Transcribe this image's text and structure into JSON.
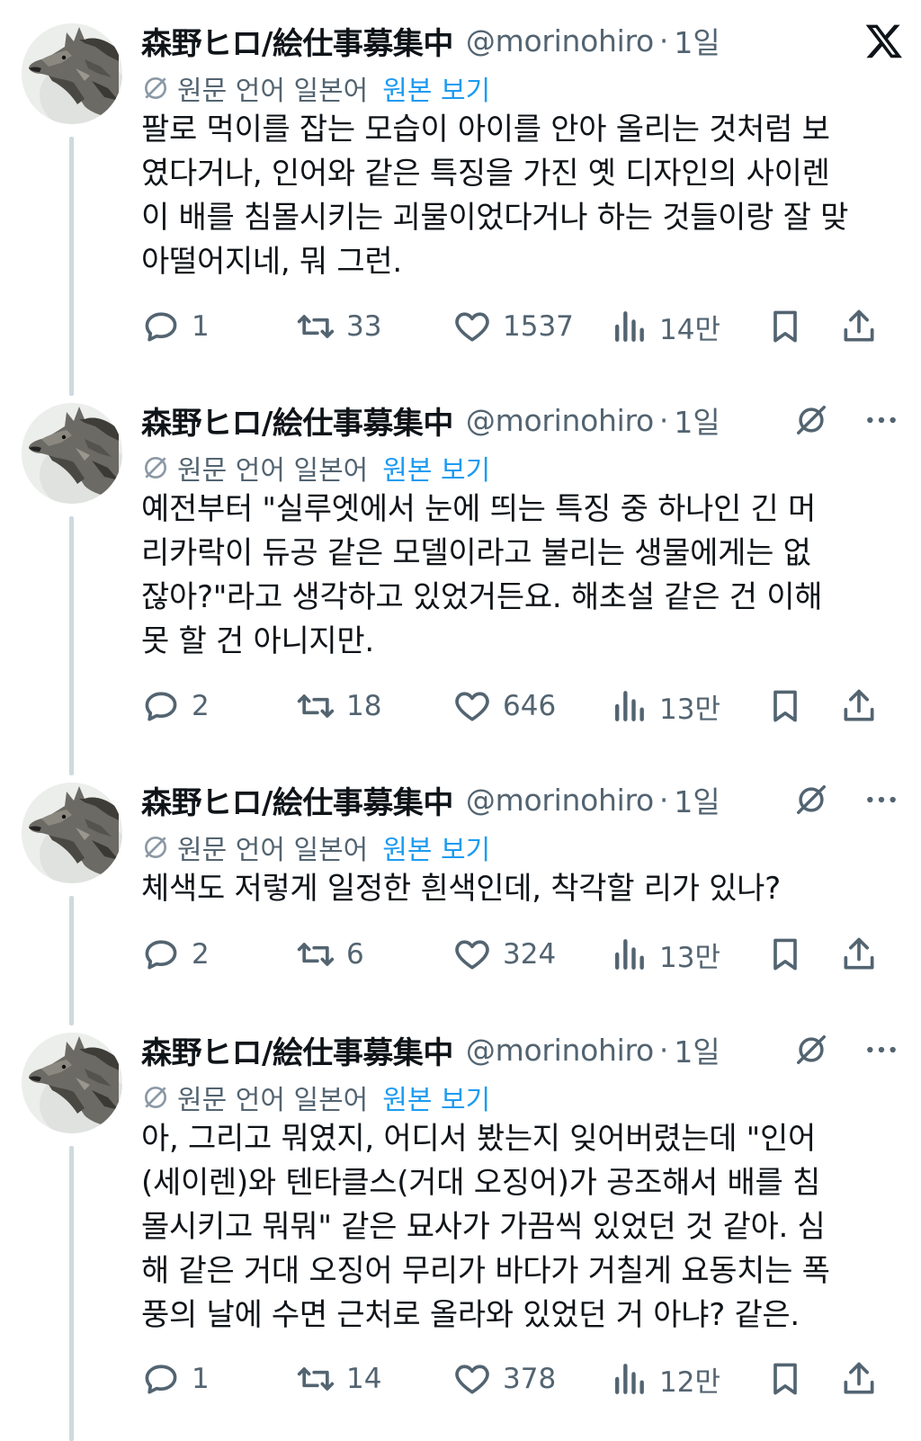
{
  "author": {
    "display_name": "森野ヒロ/絵仕事募集中",
    "handle": "@morinohiro",
    "separator": "·"
  },
  "translate_bar": {
    "original_language": "원문 언어 일본어",
    "show_original": "원본 보기"
  },
  "tweets": [
    {
      "time": "1일",
      "lines": [
        "팔로 먹이를 잡는 모습이 아이를 안아 올리는 것처럼 보",
        "였다거나, 인어와 같은 특징을 가진 옛 디자인의 사이렌",
        "이 배를 침몰시키는 괴물이었다거나 하는 것들이랑 잘 맞",
        "아떨어지네, 뭐 그런."
      ],
      "replies": "1",
      "retweets": "33",
      "likes": "1537",
      "views": "14만"
    },
    {
      "time": "1일",
      "lines": [
        "예전부터 \"실루엣에서 눈에 띄는 특징 중 하나인 긴 머",
        "리카락이 듀공 같은 모델이라고 불리는 생물에게는 없",
        "잖아?\"라고 생각하고 있었거든요. 해초설 같은 건 이해",
        "못 할 건 아니지만."
      ],
      "replies": "2",
      "retweets": "18",
      "likes": "646",
      "views": "13만"
    },
    {
      "time": "1일",
      "lines": [
        "체색도 저렇게 일정한 흰색인데, 착각할 리가 있나?"
      ],
      "replies": "2",
      "retweets": "6",
      "likes": "324",
      "views": "13만"
    },
    {
      "time": "1일",
      "lines": [
        "아, 그리고 뭐였지, 어디서 봤는지 잊어버렸는데 \"인어",
        "(세이렌)와 텐타클스(거대 오징어)가 공조해서 배를 침",
        "몰시키고 뭐뭐\" 같은 묘사가 가끔씩 있었던 것 같아. 심",
        "해 같은 거대 오징어 무리가 바다가 거칠게 요동치는 폭",
        "풍의 날에 수면 근처로 올라와 있었던 거 아냐? 같은."
      ],
      "replies": "1",
      "retweets": "14",
      "likes": "378",
      "views": "12만"
    }
  ],
  "icons": {
    "platform": "x-logo-icon",
    "grok": "grok-icon",
    "more": "more-icon",
    "translate": "translate-icon",
    "reply": "reply-icon",
    "retweet": "retweet-icon",
    "like": "heart-icon",
    "views": "views-icon",
    "bookmark": "bookmark-icon",
    "share": "share-icon"
  },
  "colors": {
    "text": "#0f1419",
    "secondary": "#536471",
    "link": "#1d9bf0",
    "thread_line": "#cfd9de"
  }
}
